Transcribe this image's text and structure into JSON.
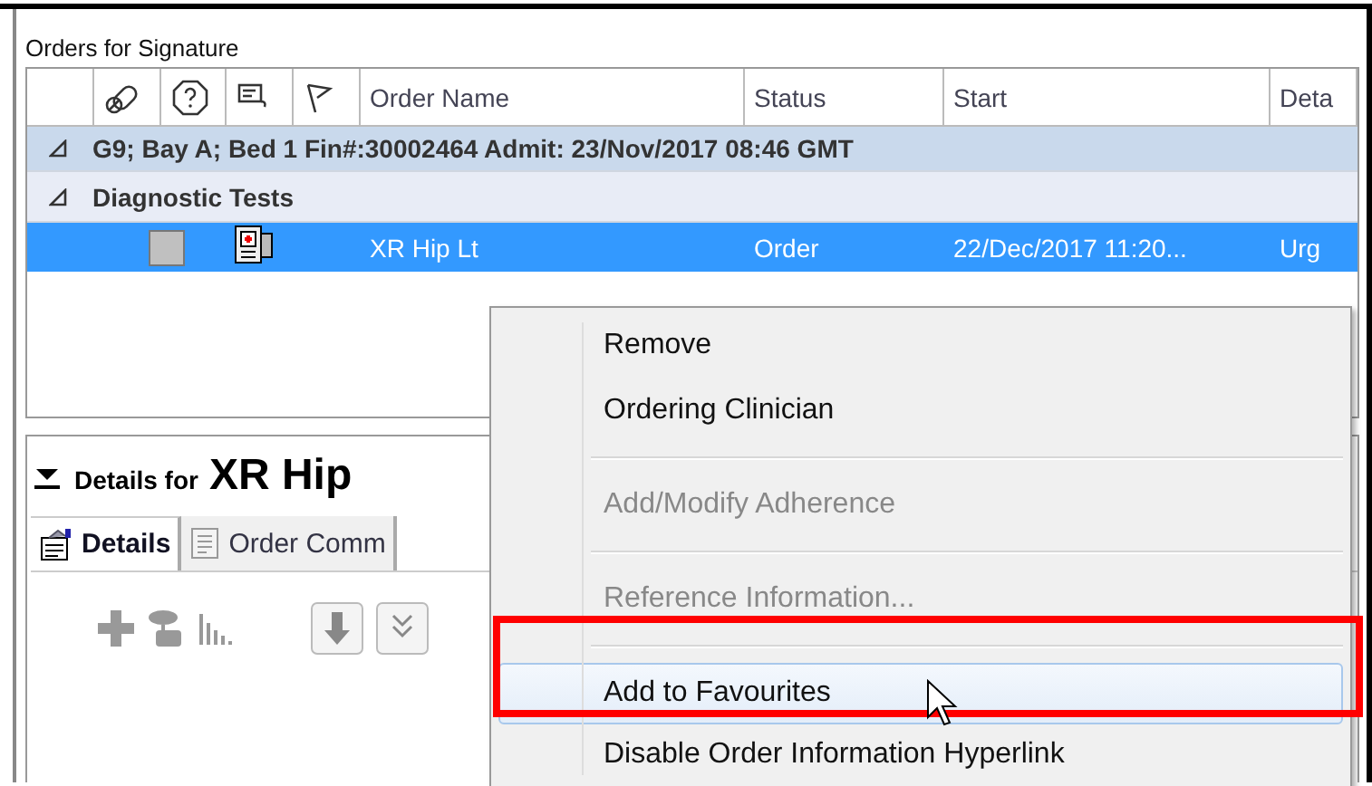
{
  "orders_panel": {
    "title": "Orders for Signature",
    "columns": [
      {
        "kind": "blank"
      },
      {
        "kind": "icon"
      },
      {
        "kind": "icon"
      },
      {
        "kind": "icon"
      },
      {
        "kind": "icon"
      },
      {
        "kind": "text",
        "label": "Order Name"
      },
      {
        "kind": "text",
        "label": "Status"
      },
      {
        "kind": "text",
        "label": "Start"
      },
      {
        "kind": "text",
        "label": "Deta"
      }
    ],
    "groups": [
      {
        "kind": "encounter",
        "label": "G9; Bay A; Bed 1  Fin#:30002464  Admit: 23/Nov/2017 08:46 GMT",
        "expanded": true
      },
      {
        "kind": "category",
        "label": "Diagnostic Tests",
        "expanded": true
      }
    ],
    "rows": [
      {
        "name": "XR Hip Lt",
        "status": "Order",
        "start": "22/Dec/2017 11:20...",
        "details": "Urg",
        "checked": false,
        "selected": true
      }
    ]
  },
  "details_panel": {
    "prefix": "Details for",
    "order": "XR Hip",
    "expanded": true,
    "tabs": [
      {
        "label": "Details",
        "selected": true
      },
      {
        "label": "Order Comm",
        "selected": false
      }
    ]
  },
  "context_menu": {
    "items": [
      {
        "kind": "item",
        "label": "Remove",
        "disabled": false,
        "selected": false
      },
      {
        "kind": "item",
        "label": "Ordering Clinician",
        "disabled": false,
        "selected": false
      },
      {
        "kind": "separator"
      },
      {
        "kind": "item",
        "label": "Add/Modify Adherence",
        "disabled": true,
        "selected": false
      },
      {
        "kind": "separator"
      },
      {
        "kind": "item",
        "label": "Reference Information...",
        "disabled": true,
        "selected": false
      },
      {
        "kind": "separator"
      },
      {
        "kind": "item",
        "label": "Add to Favourites",
        "disabled": false,
        "selected": true
      },
      {
        "kind": "item",
        "label": "Disable Order Information Hyperlink",
        "disabled": false,
        "selected": false
      }
    ]
  }
}
